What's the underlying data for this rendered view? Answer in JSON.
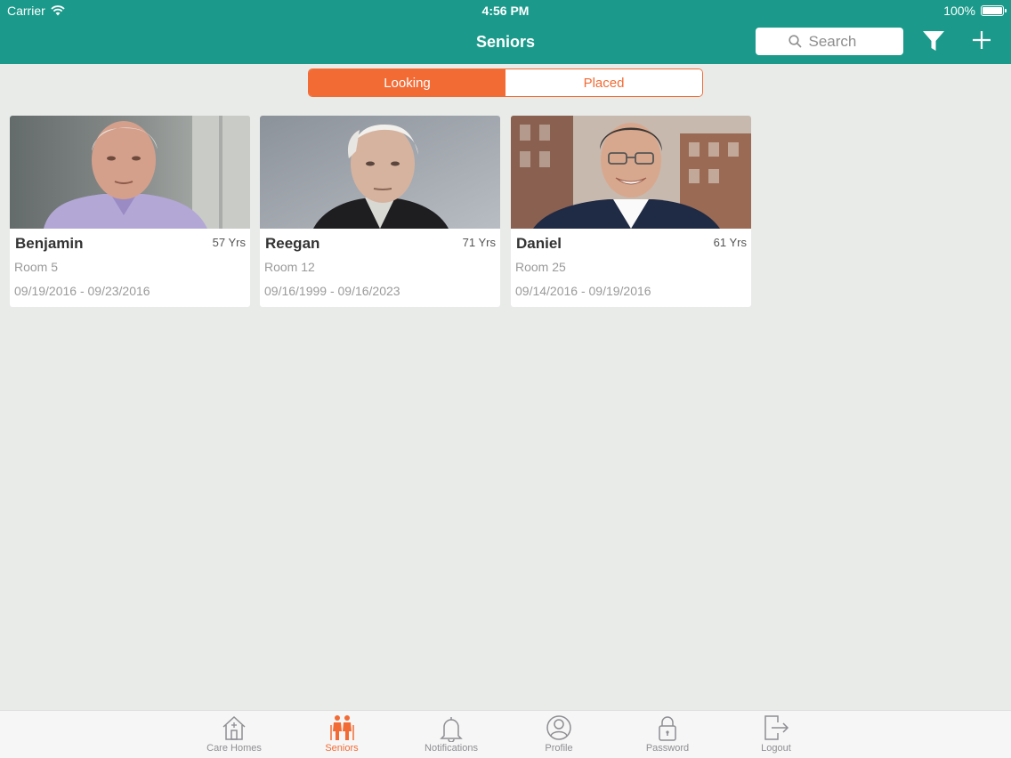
{
  "status_bar": {
    "carrier": "Carrier",
    "time": "4:56 PM",
    "battery": "100%"
  },
  "nav": {
    "title": "Seniors",
    "search_placeholder": "Search"
  },
  "segment": {
    "options": [
      "Looking",
      "Placed"
    ],
    "selected": "Looking"
  },
  "seniors": [
    {
      "name": "Benjamin",
      "age": "57 Yrs",
      "room": "Room 5",
      "dates": "09/19/2016 - 09/23/2016"
    },
    {
      "name": "Reegan",
      "age": "71 Yrs",
      "room": "Room 12",
      "dates": "09/16/1999 - 09/16/2023"
    },
    {
      "name": "Daniel",
      "age": "61 Yrs",
      "room": "Room 25",
      "dates": "09/14/2016 - 09/19/2016"
    }
  ],
  "tabs": [
    {
      "label": "Care Homes",
      "icon": "house-icon"
    },
    {
      "label": "Seniors",
      "icon": "seniors-icon",
      "active": true
    },
    {
      "label": "Notifications",
      "icon": "bell-icon"
    },
    {
      "label": "Profile",
      "icon": "profile-icon"
    },
    {
      "label": "Password",
      "icon": "lock-icon"
    },
    {
      "label": "Logout",
      "icon": "logout-icon"
    }
  ],
  "colors": {
    "teal": "#1b9a8b",
    "accent": "#f26b35",
    "background": "#e9ebe9"
  }
}
